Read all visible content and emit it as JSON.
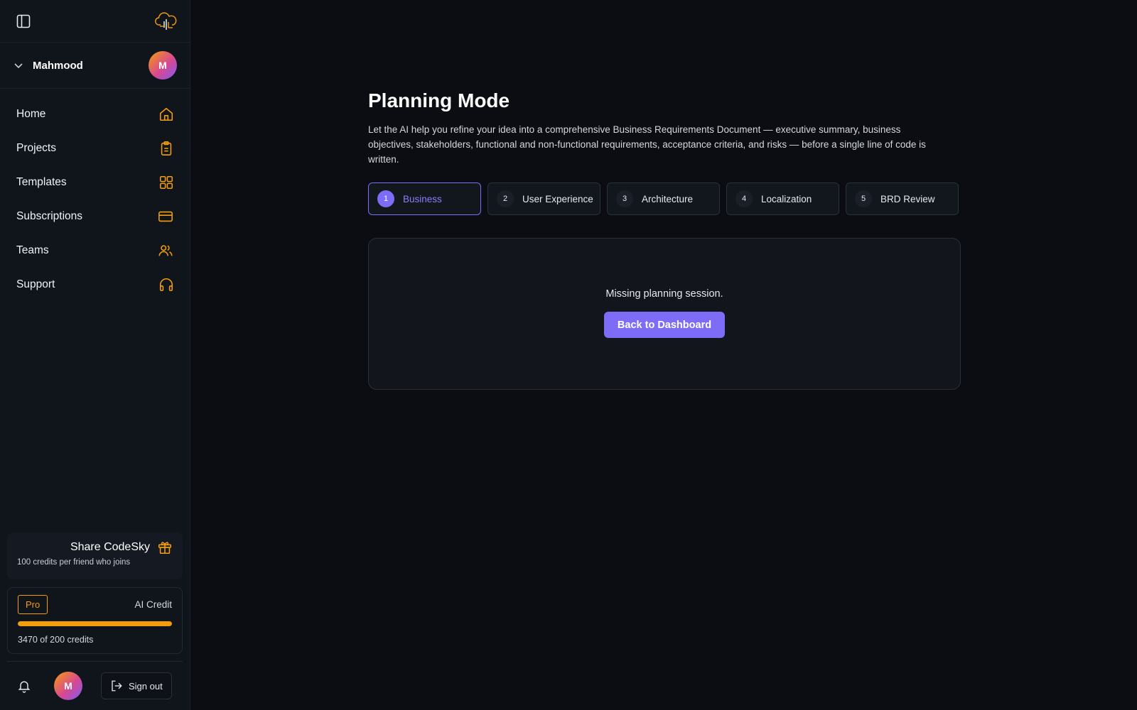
{
  "sidebar": {
    "user": {
      "name": "Mahmood",
      "avatar_initial": "M"
    },
    "nav": [
      {
        "label": "Home",
        "icon": "home-icon"
      },
      {
        "label": "Projects",
        "icon": "clipboard-icon"
      },
      {
        "label": "Templates",
        "icon": "grid-icon"
      },
      {
        "label": "Subscriptions",
        "icon": "credit-card-icon"
      },
      {
        "label": "Teams",
        "icon": "users-icon"
      },
      {
        "label": "Support",
        "icon": "headphones-icon"
      }
    ],
    "share": {
      "title": "Share CodeSky",
      "subtitle": "100 credits per friend who joins"
    },
    "credits": {
      "plan": "Pro",
      "label": "AI Credit",
      "summary": "3470 of 200 credits",
      "progress_fraction": 1.0
    },
    "footer": {
      "avatar_initial": "M",
      "signout_label": "Sign out"
    }
  },
  "main": {
    "title": "Planning Mode",
    "description": "Let the AI help you refine your idea into a comprehensive Business Requirements Document — executive summary, business objectives, stakeholders, functional and non-functional requirements, acceptance criteria, and risks — before a single line of code is written.",
    "steps": [
      {
        "num": "1",
        "label": "Business",
        "active": true
      },
      {
        "num": "2",
        "label": "User Experience",
        "active": false
      },
      {
        "num": "3",
        "label": "Architecture",
        "active": false
      },
      {
        "num": "4",
        "label": "Localization",
        "active": false
      },
      {
        "num": "5",
        "label": "BRD Review",
        "active": false
      }
    ],
    "panel": {
      "message": "Missing planning session.",
      "button_label": "Back to Dashboard"
    }
  },
  "colors": {
    "accent": "#7c6cf6",
    "brand_orange": "#f59e0b",
    "background": "#0b0d12",
    "sidebar": "#10141b"
  }
}
